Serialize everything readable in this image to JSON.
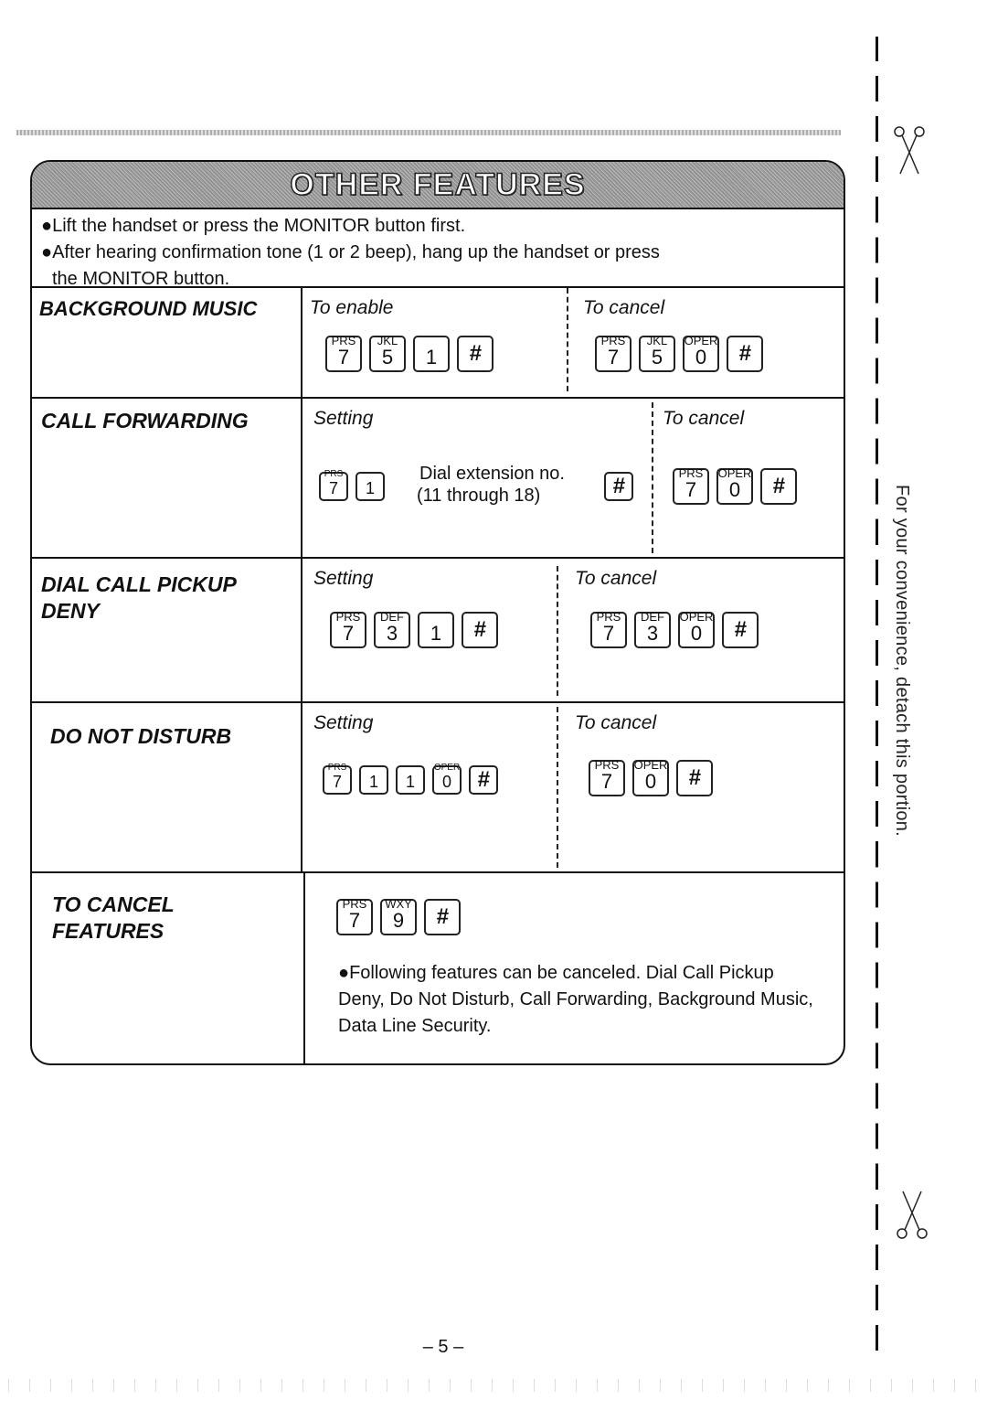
{
  "banner": {
    "title": "OTHER FEATURES"
  },
  "intro": {
    "bullets": [
      "●Lift the handset or press the MONITOR button first.",
      "●After hearing confirmation tone (1 or 2 beep), hang up the handset or press",
      "the MONITOR button."
    ]
  },
  "features": [
    {
      "label": "BACKGROUND MUSIC",
      "left_title": "To enable",
      "left_keys": [
        {
          "letters": "PRS",
          "digit": "7"
        },
        {
          "letters": "JKL",
          "digit": "5"
        },
        {
          "letters": "",
          "digit": "1"
        },
        {
          "letters": "",
          "digit": "#"
        }
      ],
      "right_title": "To cancel",
      "right_keys": [
        {
          "letters": "PRS",
          "digit": "7"
        },
        {
          "letters": "JKL",
          "digit": "5"
        },
        {
          "letters": "OPER",
          "digit": "0"
        },
        {
          "letters": "",
          "digit": "#"
        }
      ]
    },
    {
      "label": "CALL FORWARDING",
      "left_title": "Setting",
      "left_keys": [
        {
          "letters": "PRS",
          "digit": "7"
        },
        {
          "letters": "",
          "digit": "1"
        }
      ],
      "dial_text_line1": "Dial extension no.",
      "dial_text_line2": "(11 through 18)",
      "after_keys": [
        {
          "letters": "",
          "digit": "#"
        }
      ],
      "right_title": "To cancel",
      "right_keys": [
        {
          "letters": "PRS",
          "digit": "7"
        },
        {
          "letters": "OPER",
          "digit": "0"
        },
        {
          "letters": "",
          "digit": "#"
        }
      ]
    },
    {
      "label": "DIAL CALL PICKUP DENY",
      "left_title": "Setting",
      "left_keys": [
        {
          "letters": "PRS",
          "digit": "7"
        },
        {
          "letters": "DEF",
          "digit": "3"
        },
        {
          "letters": "",
          "digit": "1"
        },
        {
          "letters": "",
          "digit": "#"
        }
      ],
      "right_title": "To cancel",
      "right_keys": [
        {
          "letters": "PRS",
          "digit": "7"
        },
        {
          "letters": "DEF",
          "digit": "3"
        },
        {
          "letters": "OPER",
          "digit": "0"
        },
        {
          "letters": "",
          "digit": "#"
        }
      ]
    },
    {
      "label": "DO NOT DISTURB",
      "left_title": "Setting",
      "left_keys": [
        {
          "letters": "PRS",
          "digit": "7"
        },
        {
          "letters": "",
          "digit": "1"
        },
        {
          "letters": "",
          "digit": "1"
        },
        {
          "letters": "OPER",
          "digit": "0"
        },
        {
          "letters": "",
          "digit": "#"
        }
      ],
      "right_title": "To cancel",
      "right_keys": [
        {
          "letters": "PRS",
          "digit": "7"
        },
        {
          "letters": "OPER",
          "digit": "0"
        },
        {
          "letters": "",
          "digit": "#"
        }
      ]
    },
    {
      "label": "TO CANCEL FEATURES",
      "keys": [
        {
          "letters": "PRS",
          "digit": "7"
        },
        {
          "letters": "WXY",
          "digit": "9"
        },
        {
          "letters": "",
          "digit": "#"
        }
      ],
      "note": "●Following features can be canceled. Dial Call Pickup Deny, Do Not Disturb, Call Forwarding, Background Music, Data Line Security."
    }
  ],
  "side": {
    "vertical_note": "For your convenience, detach this portion.",
    "icons": [
      "scissors-icon",
      "scissors-icon"
    ]
  },
  "footer": {
    "page_number": "– 5 –"
  }
}
